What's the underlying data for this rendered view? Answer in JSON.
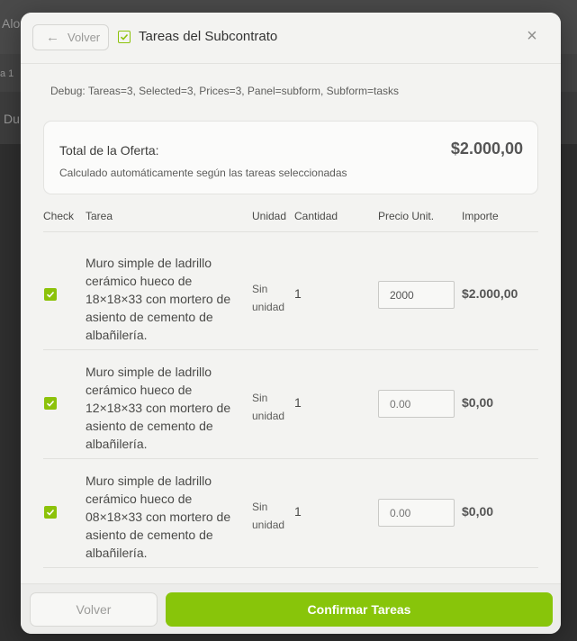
{
  "background": {
    "text_a": "Alo",
    "text_b": "a 1",
    "text_c": "Du"
  },
  "modal": {
    "back_label": "Volver",
    "title": "Tareas del Subcontrato",
    "close_icon": "close-icon",
    "debug": "Debug: Tareas=3, Selected=3, Prices=3, Panel=subform, Subform=tasks"
  },
  "total": {
    "label": "Total de la Oferta:",
    "amount": "$2.000,00",
    "subtitle": "Calculado automáticamente según las tareas seleccionadas"
  },
  "table": {
    "headers": {
      "check": "Check",
      "task": "Tarea",
      "unit": "Unidad",
      "qty": "Cantidad",
      "price": "Precio Unit.",
      "amount": "Importe"
    },
    "rows": [
      {
        "checked": true,
        "task": "Muro simple de ladrillo cerámico hueco de 18×18×33 con mortero de asiento de cemento de albañilería.",
        "unit": "Sin unidad",
        "qty": "1",
        "price_value": "2000",
        "price_placeholder": "0.00",
        "amount": "$2.000,00"
      },
      {
        "checked": true,
        "task": "Muro simple de ladrillo cerámico hueco de 12×18×33 con mortero de asiento de cemento de albañilería.",
        "unit": "Sin unidad",
        "qty": "1",
        "price_value": "",
        "price_placeholder": "0.00",
        "amount": "$0,00"
      },
      {
        "checked": true,
        "task": "Muro simple de ladrillo cerámico hueco de 08×18×33 con mortero de asiento de cemento de albañilería.",
        "unit": "Sin unidad",
        "qty": "1",
        "price_value": "",
        "price_placeholder": "0.00",
        "amount": "$0,00"
      }
    ]
  },
  "footer": {
    "back_label": "Volver",
    "confirm_label": "Confirmar Tareas"
  },
  "colors": {
    "accent": "#88c50a",
    "modal_bg": "#f3f3f1"
  }
}
